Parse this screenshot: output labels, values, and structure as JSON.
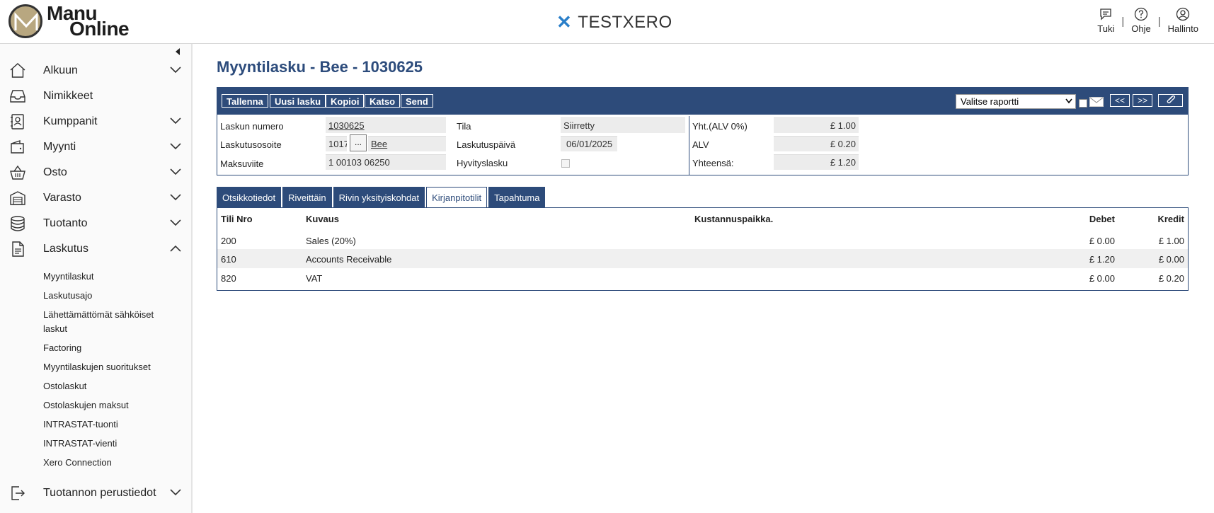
{
  "header": {
    "logo_line1": "Manu",
    "logo_line2": "Online",
    "company": "TESTXERO",
    "actions": [
      {
        "label": "Tuki",
        "icon": "chat-icon"
      },
      {
        "label": "Ohje",
        "icon": "help-icon"
      },
      {
        "label": "Hallinto",
        "icon": "user-icon"
      }
    ],
    "separator": "|"
  },
  "sidebar": {
    "collapse_icon": "chevron-left-icon",
    "items": [
      {
        "label": "Alkuun",
        "icon": "home-icon",
        "expandable": true
      },
      {
        "label": "Nimikkeet",
        "icon": "inbox-icon",
        "expandable": false
      },
      {
        "label": "Kumppanit",
        "icon": "contacts-icon",
        "expandable": true
      },
      {
        "label": "Myynti",
        "icon": "wallet-icon",
        "expandable": true
      },
      {
        "label": "Osto",
        "icon": "basket-icon",
        "expandable": true
      },
      {
        "label": "Varasto",
        "icon": "warehouse-icon",
        "expandable": true
      },
      {
        "label": "Tuotanto",
        "icon": "database-icon",
        "expandable": true
      },
      {
        "label": "Laskutus",
        "icon": "document-icon",
        "expandable": true,
        "expanded": true
      }
    ],
    "sub_items": [
      "Myyntilaskut",
      "Laskutusajo",
      "Lähettämättömät sähköiset laskut",
      "Factoring",
      "Myyntilaskujen suoritukset",
      "Ostolaskut",
      "Ostolaskujen maksut",
      "INTRASTAT-tuonti",
      "INTRASTAT-vienti",
      "Xero Connection"
    ],
    "bottom_item": {
      "label": "Tuotannon perustiedot",
      "icon": "exit-icon"
    }
  },
  "page": {
    "title": "Myyntilasku - Bee - 1030625"
  },
  "toolbar": {
    "buttons": [
      "Tallenna",
      "Uusi lasku",
      "Kopioi",
      "Katso",
      "Send"
    ],
    "report_select": "Valitse raportti",
    "prev": "<<",
    "next": ">>",
    "attach_icon": "paperclip-icon"
  },
  "invoice": {
    "number_label": "Laskun numero",
    "number": "1030625",
    "address_label": "Laskutusosoite",
    "address_code": "1017",
    "address_dots": "...",
    "address_name": "Bee",
    "ref_label": "Maksuviite",
    "ref": "1 00103 06250",
    "status_label": "Tila",
    "status": "Siirretty",
    "date_label": "Laskutuspäivä",
    "date": "06/01/2025",
    "credit_label": "Hyvityslasku",
    "net_label": "Yht.(ALV 0%)",
    "net": "£ 1.00",
    "vat_label": "ALV",
    "vat": "£ 0.20",
    "total_label": "Yhteensä:",
    "total": "£ 1.20"
  },
  "tabs": [
    {
      "label": "Otsikkotiedot",
      "active": false
    },
    {
      "label": "Riveittäin",
      "active": false
    },
    {
      "label": "Rivin yksityiskohdat",
      "active": false
    },
    {
      "label": "Kirjanpitotilit",
      "active": true
    },
    {
      "label": "Tapahtuma",
      "active": false
    }
  ],
  "ledger": {
    "columns": [
      "Tili Nro",
      "Kuvaus",
      "Kustannuspaikka.",
      "Debet",
      "Kredit"
    ],
    "rows": [
      {
        "account": "200",
        "description": "Sales (20%)",
        "cost_center": "",
        "debit": "£ 0.00",
        "credit": "£ 1.00"
      },
      {
        "account": "610",
        "description": "Accounts Receivable",
        "cost_center": "",
        "debit": "£ 1.20",
        "credit": "£ 0.00"
      },
      {
        "account": "820",
        "description": "VAT",
        "cost_center": "",
        "debit": "£ 0.00",
        "credit": "£ 0.20"
      }
    ]
  },
  "colors": {
    "accent": "#2d4b7a",
    "brand_blue": "#2a7fc9"
  }
}
